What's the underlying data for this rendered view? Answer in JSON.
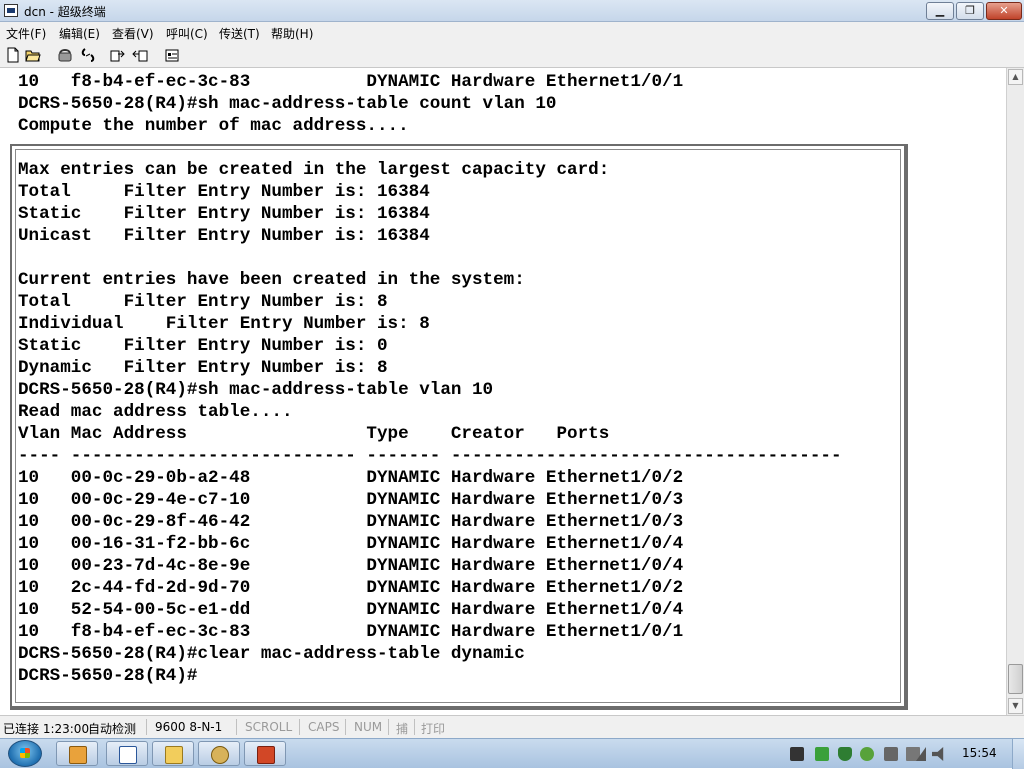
{
  "window": {
    "title": "dcn - 超级终端",
    "minimize_glyph": "▁",
    "maximize_glyph": "❐",
    "close_glyph": "✕"
  },
  "menu": {
    "items": [
      "文件(F)",
      "编辑(E)",
      "查看(V)",
      "呼叫(C)",
      "传送(T)",
      "帮助(H)"
    ]
  },
  "toolbar": {
    "icons": [
      "new-file-icon",
      "open-folder-icon",
      "phone-connect-icon",
      "disconnect-icon",
      "send-file-icon",
      "receive-file-icon",
      "properties-icon"
    ]
  },
  "terminal": {
    "lines": [
      "10   f8-b4-ef-ec-3c-83           DYNAMIC Hardware Ethernet1/0/1",
      "DCRS-5650-28(R4)#sh mac-address-table count vlan 10",
      "Compute the number of mac address....",
      "",
      "Max entries can be created in the largest capacity card:",
      "Total     Filter Entry Number is: 16384",
      "Static    Filter Entry Number is: 16384",
      "Unicast   Filter Entry Number is: 16384",
      "",
      "Current entries have been created in the system:",
      "Total     Filter Entry Number is: 8",
      "Individual    Filter Entry Number is: 8",
      "Static    Filter Entry Number is: 0",
      "Dynamic   Filter Entry Number is: 8",
      "DCRS-5650-28(R4)#sh mac-address-table vlan 10",
      "Read mac address table....",
      "Vlan Mac Address                 Type    Creator   Ports",
      "---- --------------------------- ------- -------------------------------------",
      "10   00-0c-29-0b-a2-48           DYNAMIC Hardware Ethernet1/0/2",
      "10   00-0c-29-4e-c7-10           DYNAMIC Hardware Ethernet1/0/3",
      "10   00-0c-29-8f-46-42           DYNAMIC Hardware Ethernet1/0/3",
      "10   00-16-31-f2-bb-6c           DYNAMIC Hardware Ethernet1/0/4",
      "10   00-23-7d-4c-8e-9e           DYNAMIC Hardware Ethernet1/0/4",
      "10   2c-44-fd-2d-9d-70           DYNAMIC Hardware Ethernet1/0/2",
      "10   52-54-00-5c-e1-dd           DYNAMIC Hardware Ethernet1/0/4",
      "10   f8-b4-ef-ec-3c-83           DYNAMIC Hardware Ethernet1/0/1",
      "DCRS-5650-28(R4)#clear mac-address-table dynamic",
      "DCRS-5650-28(R4)#"
    ]
  },
  "status": {
    "connection": "已连接 1:23:00",
    "detect": "自动检测",
    "baud": "9600 8-N-1",
    "scroll": "SCROLL",
    "caps": "CAPS",
    "num": "NUM",
    "capture": "捕",
    "print": "打印"
  },
  "taskbar": {
    "clock": "15:54",
    "apps": [
      "explorer-app-icon",
      "word-app-icon",
      "folder-app-icon",
      "package-app-icon",
      "powerpoint-app-icon"
    ],
    "tray": [
      "network-device-icon",
      "battery-icon",
      "shield-icon",
      "chat-icon",
      "usb-icon",
      "clipboard-icon",
      "signal-icon",
      "volume-icon"
    ]
  },
  "colors": {
    "terminal_bg": "#ffffff",
    "terminal_text": "#000000",
    "title_bar": "#c6d6ea",
    "close_button": "#c0432a",
    "taskbar": "#a9c3e0"
  }
}
